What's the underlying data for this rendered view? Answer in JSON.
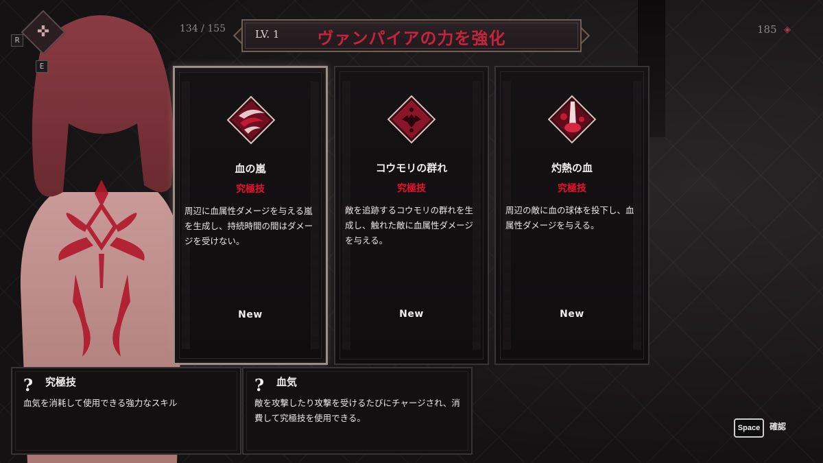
{
  "hud": {
    "key_r": "R",
    "key_e": "E",
    "left_counter": "134 / 155",
    "right_counter": "185",
    "right_counter_icon": "blood-gem-icon",
    "slot_icon": "crosshair-emblem-icon"
  },
  "banner": {
    "level": "LV. 1",
    "title": "ヴァンパイアの力を強化"
  },
  "cards": [
    {
      "name": "血の嵐",
      "tag": "究極技",
      "description": "周辺に血属性ダメージを与える嵐を生成し、持続時間の間はダメージを受けない。",
      "status": "New",
      "icon": "blood-storm-icon",
      "selected": true
    },
    {
      "name": "コウモリの群れ",
      "tag": "究極技",
      "description": "敵を追跡するコウモリの群れを生成し、触れた敵に血属性ダメージを与える。",
      "status": "New",
      "icon": "bat-swarm-icon",
      "selected": false
    },
    {
      "name": "灼熱の血",
      "tag": "究極技",
      "description": "周辺の敵に血の球体を投下し、血属性ダメージを与える。",
      "status": "New",
      "icon": "burning-blood-icon",
      "selected": false
    }
  ],
  "info": [
    {
      "mark": "?",
      "title": "究極技",
      "text": "血気を消耗して使用できる強力なスキル"
    },
    {
      "mark": "?",
      "title": "血気",
      "text": "敵を攻撃したり攻撃を受けるたびにチャージされ、消費して究極技を使用できる。"
    }
  ],
  "prompt": {
    "key": "Space",
    "label": "確認"
  },
  "colors": {
    "accent_red": "#e8102c",
    "title_red": "#c4243d",
    "selected_border": "#9f8e84"
  }
}
